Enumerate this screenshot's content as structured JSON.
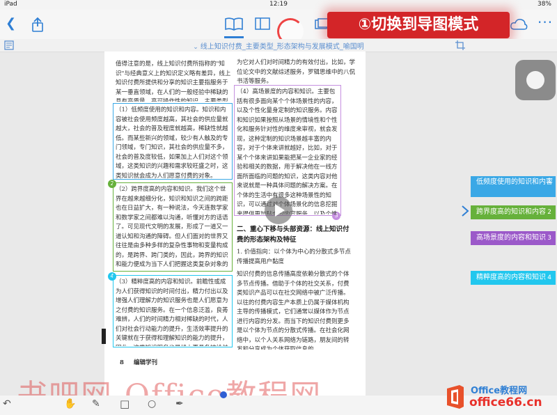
{
  "status": {
    "device": "iPad",
    "time": "12:19",
    "battery": "38%"
  },
  "toolbar": {
    "annotation": "①切换到导图模式"
  },
  "doc_title": "线上知识付费_主要类型_形态架构与发展模式_喻国明",
  "page": {
    "left_column": {
      "intro": [
        "值得注意的是，线上知识付费所指称的\"知识\"与经典意义上的知识定义略有差异，线上知识付费所提供和分享的知识主要指服务于某一垂直领域，在人们的一般经验中稀缺的具有高质量、高可操作性的知识。主要类型如下："
      ],
      "box1": "（1）低频度使用的知识和内容。知识和内容被社会使用频度越高，其社会的供应量就越大，社会的普及程度就越高，稀缺性就越低。而某些新兴的领域，较少有人触及的专门领域，专门知识，其社会的供应量不多，社会的普及度较低，如果加上人们对这个领域，这类知识的兴趣和需求较旺盛之时，这类知识就会成为人们愿意付费的对象。",
      "box2": "（2）跨界度高的内容和知识。我们这个世界在越来越细分化，知识和知识之间的跨距也在日益扩大，有一种说法，今天连数学家和数学家之间都难以沟通，听懂对方的话语了。可见现代文明的发展，形成了一道又一道认知和沟通的障碍。但人们面对的世界又往往是由多种多样的复杂性事物和变量构成的，是跨界、跨门类的，因此，跨界的知识和能力便成为当下人们把握这类复杂对象的核心能力，能够提供人们这种能力的内容服务，当然有人愿意为它付费。",
      "box3": "（3）精粹度高的内容和知识。前瞻性或成为人们获得知识的时间付出，精力付出以及增强人们理解力的知识服务也是人们愿意为之付费的知识服务。在一个信息泛滥，良莠难辨，人们的时间精力相对稀缺的时代，人们对社会行动能力的提升，生活效率提升的关键就在于获得和理解知识的能力的提升，因此，这类知识服务也是线上更具备被给付的特征，但是，当它以一种简约、",
      "page_number": "8",
      "footer": "编辑学刊"
    },
    "right_column": {
      "intro": "为它对人们对时间精力的有效付出，比如，学位论文中的文献综述服务，罗辑思维中的八侃书活等服务。",
      "box4": "（4）高场景度的内容和知识。主要包括有很多面向某个个体场景性的内容，以及个性化量身定制的知识服务。内容和知识如果按照从场景的情境性和个性化和服务针对性的维度来审视，就会发现，这种定制的知识场景越丰富的内容，对于个体来讲就越好，比如，对于某个个体来讲如果能把某一企业家的经验和相关的数据，用于解决他在一线方面所面临的问题的知识，这类内容对他来说就是一种具体问题的解决方案。在个体的生活中有很多这种场景性的知识，可以通过对个体场景化的信息挖掘来提供更加贴合的内容服务，以及个性化对所需要的专业知识更加清楚的方面获得某种需求的满足，所以场景化的知识就会为越来越多的人所需要和付费。",
      "heading": "二、重心下移与头部资源：线上知识付费的形态架构及特征",
      "sub": "1. 价值指向：以个体为中心的分散式多节点传播提高用户黏度",
      "body": "知识付费的信息传播高度依赖分散式的个体多节点传播。借助于个体的社交关系，付费类知识产品可以在社交网络中被广泛传播。以往的付费内容生产本质上仍属于媒体机构主导的传播模式，它们通常以媒体作为节点进行内容的分发。而当下的知识付费则更多是以个体为节点的分散式传播。在社会化网络中，以个人关系网络为链路，朋友间的转发和分享成为个体获取信息的"
    }
  },
  "mindmap": {
    "items": [
      {
        "label": "低频度使用的知识和内容",
        "num": "1",
        "color": "#3aa8e6"
      },
      {
        "label": "跨界度高的知识和内容",
        "num": "2",
        "color": "#66b13b"
      },
      {
        "label": "高场景度的内容和知识",
        "num": "3",
        "color": "#9b59c9"
      },
      {
        "label": "精粹度高的内容和知识",
        "num": "4",
        "color": "#22c7ee"
      }
    ]
  },
  "watermark": "书吧网-Office教程网",
  "logo": {
    "brand": "Office教程网",
    "site": "office66.cn"
  }
}
